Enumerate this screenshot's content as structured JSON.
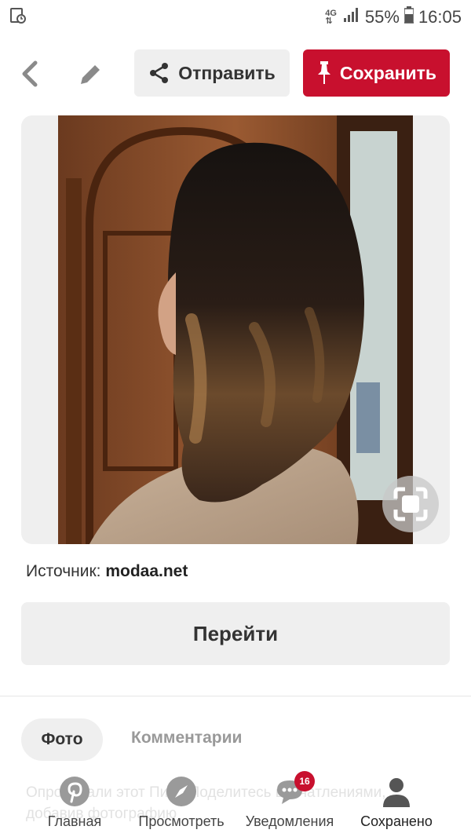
{
  "status_bar": {
    "network": "4G",
    "battery": "55%",
    "time": "16:05"
  },
  "actions": {
    "share_label": "Отправить",
    "save_label": "Сохранить"
  },
  "source": {
    "prefix": "Источник:",
    "domain": "modaa.net"
  },
  "go_button": "Перейти",
  "tabs": [
    {
      "label": "Фото",
      "active": true
    },
    {
      "label": "Комментарии",
      "active": false
    }
  ],
  "background_text": "Опробовали этот Пин? Поделитесь впечатлениями, добавив фотографию",
  "bottom_nav": [
    {
      "label": "Главная",
      "icon": "pinterest-logo-icon"
    },
    {
      "label": "Просмотреть",
      "icon": "compass-icon"
    },
    {
      "label": "Уведомления",
      "icon": "chat-bubble-icon",
      "badge": "16"
    },
    {
      "label": "Сохранено",
      "icon": "person-icon"
    }
  ],
  "colors": {
    "brand_red": "#c8102e",
    "button_gray": "#efefef"
  }
}
